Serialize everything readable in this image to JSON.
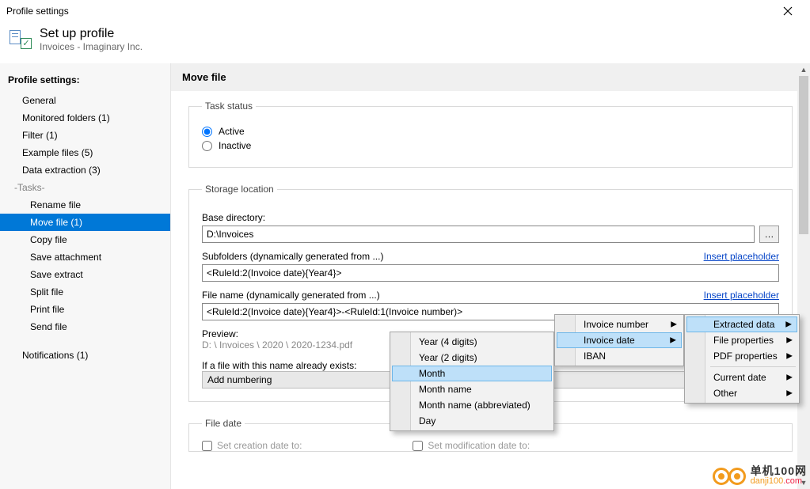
{
  "window": {
    "title": "Profile settings"
  },
  "header": {
    "title": "Set up profile",
    "subtitle": "Invoices - Imaginary Inc."
  },
  "sidebar": {
    "title": "Profile settings:",
    "items": [
      {
        "label": "General"
      },
      {
        "label": "Monitored folders (1)"
      },
      {
        "label": "Filter (1)"
      },
      {
        "label": "Example files (5)"
      },
      {
        "label": "Data extraction (3)"
      }
    ],
    "tasksHeader": "-Tasks-",
    "tasks": [
      {
        "label": "Rename file"
      },
      {
        "label": "Move file (1)",
        "selected": true
      },
      {
        "label": "Copy file"
      },
      {
        "label": "Save attachment"
      },
      {
        "label": "Save extract"
      },
      {
        "label": "Split file"
      },
      {
        "label": "Print file"
      },
      {
        "label": "Send file"
      }
    ],
    "notifications": "Notifications (1)"
  },
  "panel": {
    "title": "Move file",
    "taskStatus": {
      "legend": "Task status",
      "activeLabel": "Active",
      "inactiveLabel": "Inactive",
      "active": true
    },
    "storage": {
      "legend": "Storage location",
      "baseDirLabel": "Base directory:",
      "baseDir": "D:\\Invoices",
      "subfoldersLabel": "Subfolders (dynamically generated from ...)",
      "subfolders": "<RuleId:2(Invoice date){Year4}>",
      "insertPlaceholder": "Insert placeholder",
      "fileNameLabel": "File name (dynamically generated from ...)",
      "fileName": "<RuleId:2(Invoice date){Year4}>-<RuleId:1(Invoice number)>",
      "previewLabel": "Preview:",
      "previewPath": "D: \\ Invoices \\ 2020 \\ 2020-1234.pdf",
      "existsLabel": "If a file with this name already exists:",
      "addNumbering": "Add numbering"
    },
    "fileDate": {
      "legend": "File date",
      "setCreation": "Set creation date to:",
      "setModification": "Set modification date to:"
    }
  },
  "menus": {
    "dateParts": [
      "Year (4 digits)",
      "Year (2 digits)",
      "Month",
      "Month name",
      "Month name (abbreviated)",
      "Day"
    ],
    "datePartsHighlightIndex": 2,
    "dataFields": [
      "Invoice number",
      "Invoice date",
      "IBAN"
    ],
    "dataFieldsHighlightIndex": 1,
    "categories": [
      {
        "label": "Extracted data",
        "sub": true
      },
      {
        "label": "File properties",
        "sub": true
      },
      {
        "label": "PDF properties",
        "sub": true
      }
    ],
    "categoriesHighlightIndex": 0,
    "categories2": [
      {
        "label": "Current date",
        "sub": true
      },
      {
        "label": "Other",
        "sub": true
      }
    ]
  },
  "watermark": {
    "big": "单机100网",
    "url": "danji100",
    "urlSuffix": ".com"
  }
}
